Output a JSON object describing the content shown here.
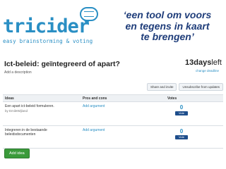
{
  "brand": {
    "name": "tricider",
    "tagline": "easy brainstorming & voting"
  },
  "quote": {
    "line1": "‘een tool om voors",
    "line2": "en tegens in kaart",
    "line3": "te brengen’"
  },
  "question": {
    "title": "Ict-beleid: geïntegreerd of apart?",
    "add_description": "Add a description"
  },
  "deadline": {
    "days": "13",
    "unit": "days",
    "suffix": "left",
    "change_label": "change deadline"
  },
  "actions": {
    "share_invite": "Share and invite",
    "unsubscribe": "Unsubscribe from updates"
  },
  "table": {
    "headers": [
      "Ideas",
      "Pros and cons",
      "Votes"
    ],
    "rows": [
      {
        "idea": "Een apart ict-beleid formuleren.",
        "author": "by EmileWijland",
        "add_argument": "Add argument",
        "votes": "0",
        "vote_button": "Vote"
      },
      {
        "idea": "Integreren in de bestaande beleidsdocumenten",
        "author": "",
        "add_argument": "Add argument",
        "votes": "0",
        "vote_button": "Vote"
      }
    ]
  },
  "add_idea_label": "Add idea",
  "colors": {
    "brand_blue": "#2a8fc4",
    "quote_navy": "#1f3d7a",
    "vote_button": "#1e4e8c",
    "add_idea_green": "#3a9a3a"
  }
}
